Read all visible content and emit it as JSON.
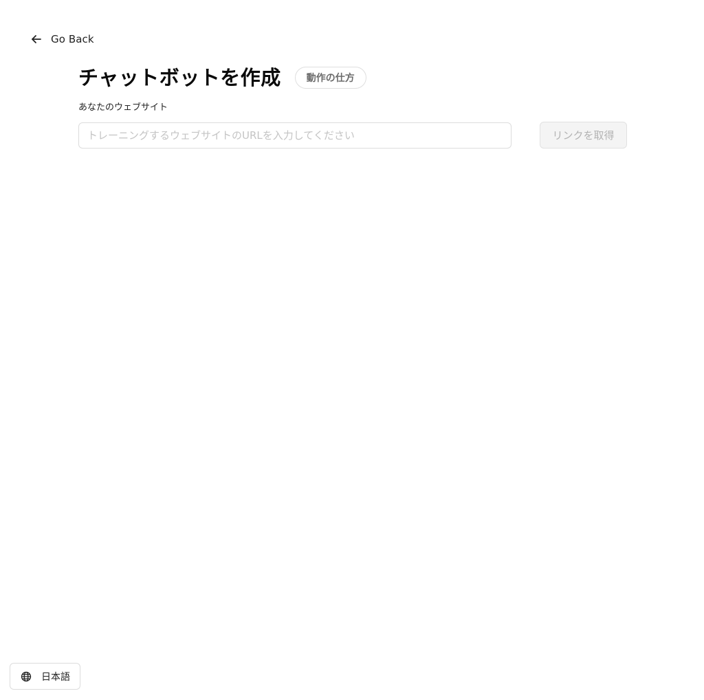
{
  "nav": {
    "back_label": "Go Back",
    "back_icon": "arrow-left-icon"
  },
  "header": {
    "title": "チャットボットを作成",
    "how_it_works_label": "動作の仕方"
  },
  "form": {
    "website_label": "あなたのウェブサイト",
    "url_value": "",
    "url_placeholder": "トレーニングするウェブサイトのURLを入力してください",
    "fetch_links_label": "リンクを取得",
    "fetch_links_disabled": true
  },
  "footer": {
    "language_label": "日本語",
    "language_icon": "globe-icon"
  },
  "colors": {
    "background": "#ffffff",
    "text": "#111111",
    "border": "#dcdcdc",
    "disabled_bg": "#f4f4f4",
    "disabled_text": "#b3b3b3",
    "placeholder": "#c4c4c4"
  }
}
